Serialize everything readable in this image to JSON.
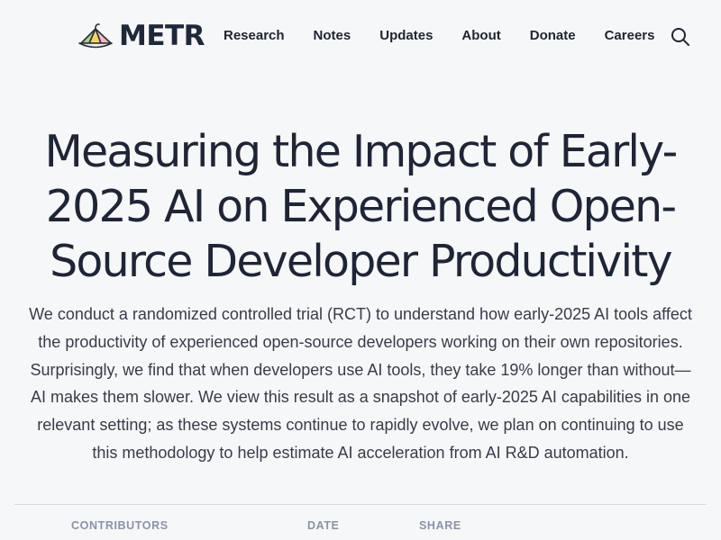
{
  "header": {
    "brand_name": "METR",
    "logo_icon": "metr-logo-icon",
    "nav": [
      {
        "label": "Research"
      },
      {
        "label": "Notes"
      },
      {
        "label": "Updates"
      },
      {
        "label": "About"
      },
      {
        "label": "Donate"
      },
      {
        "label": "Careers"
      }
    ],
    "search_icon": "search-icon"
  },
  "article": {
    "title": "Measuring the Impact of Early-2025 AI on Experienced Open-Source Developer Productivity",
    "abstract": "We conduct a randomized controlled trial (RCT) to understand how early-2025 AI tools affect the productivity of experienced open-source developers working on their own repositories. Surprisingly, we find that when developers use AI tools, they take 19% longer than without—AI makes them slower. We view this result as a snapshot of early-2025 AI capabilities in one relevant setting; as these systems continue to rapidly evolve, we plan on continuing to use this methodology to help estimate AI acceleration from AI R&D automation.",
    "meta_labels": {
      "contributors": "CONTRIBUTORS",
      "date": "DATE",
      "share": "SHARE"
    }
  },
  "colors": {
    "background": "#f6f7f9",
    "text": "#1f2430",
    "muted_label": "#8a93a6",
    "logo_green": "#a9d18e",
    "logo_yellow": "#f2d46b",
    "logo_pink": "#f2b8c2"
  }
}
